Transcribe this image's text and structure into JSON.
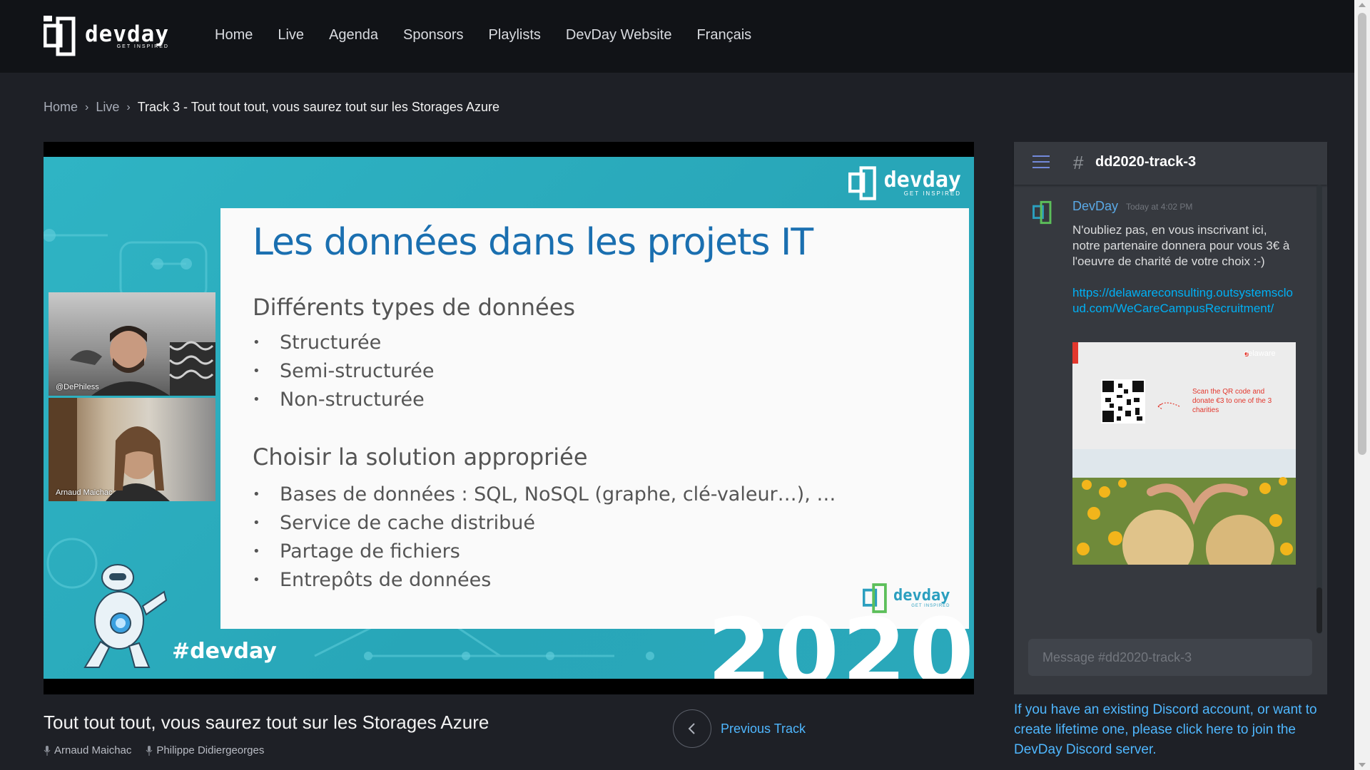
{
  "header": {
    "logo_word": "devday",
    "logo_tagline": "GET INSPIRED",
    "nav": [
      "Home",
      "Live",
      "Agenda",
      "Sponsors",
      "Playlists",
      "DevDay Website",
      "Français"
    ]
  },
  "breadcrumb": {
    "items": [
      "Home",
      "Live"
    ],
    "current": "Track 3 - Tout tout tout, vous saurez tout sur les Storages Azure"
  },
  "video": {
    "slide": {
      "title": "Les données dans les projets IT",
      "section1": "Différents types de données",
      "list1": [
        "Structurée",
        "Semi-structurée",
        "Non-structurée"
      ],
      "section2": "Choisir la solution appropriée",
      "list2": [
        "Bases de données : SQL, NoSQL (graphe, clé-valeur…), …",
        "Service de cache distribué",
        "Partage de fichiers",
        "Entrepôts de données"
      ],
      "logo_word": "devday",
      "logo_tagline": "GET INSPIRED",
      "hashtag": "#devday",
      "year": "2020"
    },
    "cameras": [
      {
        "label": "@DePhiless"
      },
      {
        "label": "Arnaud Maichac"
      }
    ]
  },
  "talk": {
    "title": "Tout tout tout, vous saurez tout sur les Storages Azure",
    "speakers": [
      "Arnaud Maichac",
      "Philippe Didiergeorges"
    ],
    "prev_label": "Previous Track"
  },
  "discord": {
    "channel": "dd2020-track-3",
    "message": {
      "author": "DevDay",
      "time": "Today at 4:02 PM",
      "text": "N'oubliez pas, en vous inscrivant ici, notre partenaire donnera pour vous 3€ à l'oeuvre de charité de votre choix :-)",
      "link": "https://delawareconsulting.outsystemscloud.com/WeCareCampusRecruitment/",
      "embed": {
        "brand": "delaware",
        "caption": "Scan the QR code and donate €3 to one of the 3 charities"
      }
    },
    "input_placeholder": "Message #dd2020-track-3",
    "note": "If you have an existing Discord account, or want to create lifetime one, please click here to join the DevDay Discord server."
  },
  "colors": {
    "header_bg": "#111317",
    "page_bg": "#1e2026",
    "link_blue": "#4fb7ff",
    "discord_bg": "#36393f",
    "slide_teal": "#2fb4c4",
    "slide_title_blue": "#1a6fb0"
  }
}
